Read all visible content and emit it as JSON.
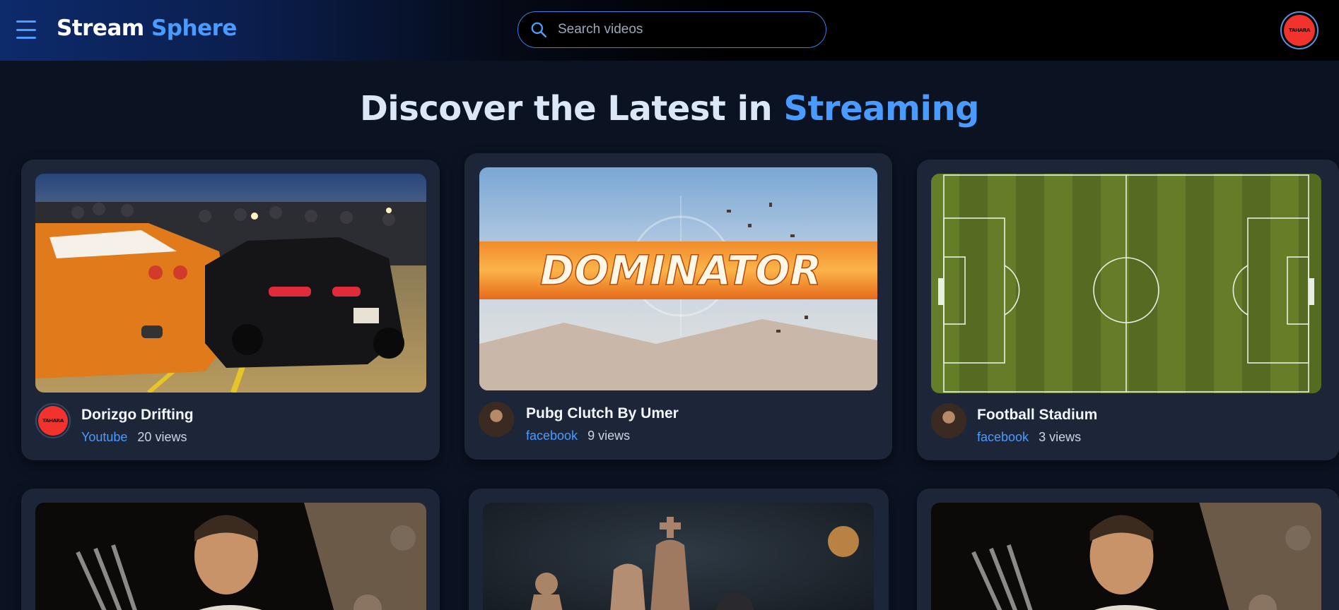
{
  "header": {
    "brand_part1": "Stream",
    "brand_part2": "Sphere",
    "search_placeholder": "Search videos",
    "profile_label": "TAHARA"
  },
  "hero": {
    "title_part1": "Discover the Latest in ",
    "title_accent": "Streaming"
  },
  "videos": [
    {
      "title": "Dorizgo Drifting",
      "source": "Youtube",
      "views": "20 views",
      "avatar": "TAHARA",
      "thumb": "cars-night-scene"
    },
    {
      "title": "Pubg Clutch By Umer",
      "source": "facebook",
      "views": "9 views",
      "thumb": "dominator-banner",
      "thumb_text": "DOMINATOR"
    },
    {
      "title": "Football Stadium",
      "source": "facebook",
      "views": "3 views",
      "thumb": "football-pitch-aerial"
    },
    {
      "thumb": "fighter-scene"
    },
    {
      "thumb": "chess-pieces"
    },
    {
      "thumb": "fighter-scene"
    }
  ],
  "colors": {
    "accent": "#4a9bff",
    "background": "#0b1222",
    "card": "#1d2638"
  }
}
